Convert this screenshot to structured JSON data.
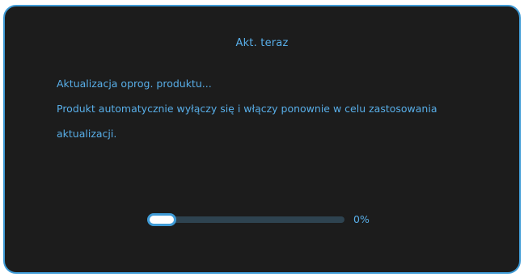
{
  "dialog": {
    "title": "Akt. teraz",
    "message_lines": [
      "Aktualizacja oprog. produktu...",
      "Produkt automatycznie wyłączy się i włączy ponownie w celu zastosowania",
      "aktualizacji."
    ]
  },
  "progress": {
    "value_percent": 0,
    "label": "0%"
  },
  "colors": {
    "background": "#1c1c1c",
    "accent": "#3f9bd6",
    "text": "#58aee8",
    "track": "#2e4350"
  }
}
